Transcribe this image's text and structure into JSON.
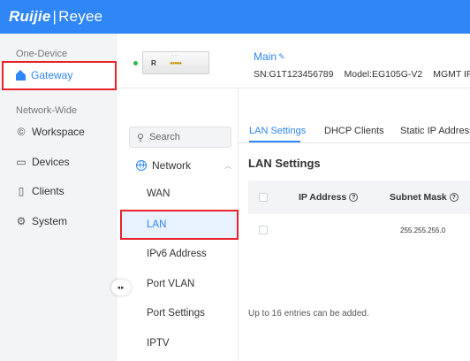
{
  "header": {
    "logo_brand": "Ruijie",
    "logo_sep": "|",
    "logo_product": "Reyee"
  },
  "sidebar": {
    "section1_label": "One-Device",
    "gateway_label": "Gateway",
    "section2_label": "Network-Wide",
    "items": [
      {
        "label": "Workspace",
        "icon": "workspace-icon"
      },
      {
        "label": "Devices",
        "icon": "devices-icon"
      },
      {
        "label": "Clients",
        "icon": "clients-icon"
      },
      {
        "label": "System",
        "icon": "system-icon"
      }
    ]
  },
  "device": {
    "name": "Main",
    "sn": "SN:G1T123456789",
    "model": "Model:EG105G-V2",
    "mgmt": "MGMT IP:",
    "status_color": "#2fbf46",
    "image_brand": "R"
  },
  "subnav": {
    "search_placeholder": "Search",
    "group_label": "Network",
    "items": [
      "WAN",
      "LAN",
      "IPv6 Address",
      "Port VLAN",
      "Port Settings",
      "IPTV"
    ],
    "active": "LAN"
  },
  "tabs": [
    "LAN Settings",
    "DHCP Clients",
    "Static IP Addresses"
  ],
  "content": {
    "title": "LAN Settings",
    "columns": [
      "IP Address",
      "Subnet Mask"
    ],
    "rows": [
      {
        "ip": "",
        "mask": "255.255.255.0"
      }
    ],
    "note": "Up to 16 entries can be added."
  },
  "colors": {
    "accent": "#2f86f6",
    "highlight_box": "#e8232b"
  }
}
